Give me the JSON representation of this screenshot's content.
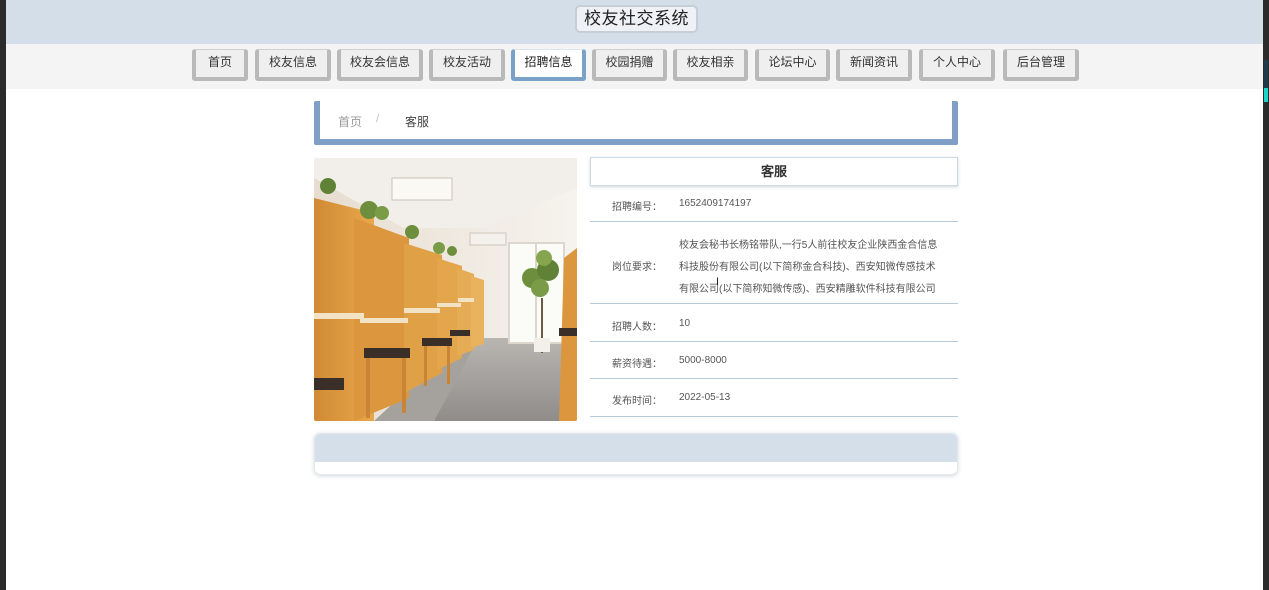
{
  "header": {
    "site_title": "校友社交系统"
  },
  "nav": {
    "items": [
      {
        "label": "首页",
        "active": false
      },
      {
        "label": "校友信息",
        "active": false
      },
      {
        "label": "校友会信息",
        "active": false
      },
      {
        "label": "校友活动",
        "active": false
      },
      {
        "label": "招聘信息",
        "active": true
      },
      {
        "label": "校园捐赠",
        "active": false
      },
      {
        "label": "校友相亲",
        "active": false
      },
      {
        "label": "论坛中心",
        "active": false
      },
      {
        "label": "新闻资讯",
        "active": false
      },
      {
        "label": "个人中心",
        "active": false
      },
      {
        "label": "后台管理",
        "active": false
      }
    ]
  },
  "breadcrumb": {
    "home": "首页",
    "separator": "/",
    "current": "客服"
  },
  "detail": {
    "title": "客服",
    "fields": [
      {
        "label": "招聘编号：",
        "value": "1652409174197"
      },
      {
        "label": "岗位要求：",
        "value": "校友会秘书长杨铭带队,一行5人前往校友企业陕西金合信息科技股份有限公司(以下简称金合科技)、西安知微传感技术有限公司(以下简称知微传感)、西安精雕软件科技有限公司(以下简称西"
      },
      {
        "label": "招聘人数：",
        "value": "10"
      },
      {
        "label": "薪资待遇：",
        "value": "5000-8000"
      },
      {
        "label": "发布时间：",
        "value": "2022-05-13"
      }
    ]
  },
  "colors": {
    "header_bg": "#d4dee8",
    "accent": "#7f9fc6",
    "nav_border": "#b9b9b9",
    "divider": "#b8c9d8"
  }
}
